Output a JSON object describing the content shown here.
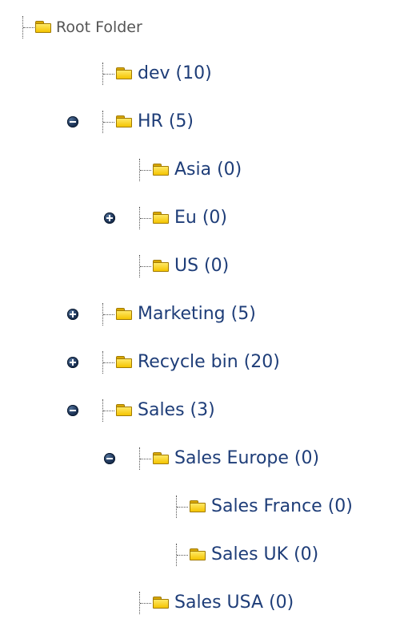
{
  "tree": {
    "root": {
      "label": "Root Folder"
    },
    "nodes": [
      {
        "label": "dev (10)",
        "depth": 1,
        "toggle": "none"
      },
      {
        "label": "HR (5)",
        "depth": 1,
        "toggle": "minus"
      },
      {
        "label": "Asia (0)",
        "depth": 2,
        "toggle": "none"
      },
      {
        "label": "Eu (0)",
        "depth": 2,
        "toggle": "plus"
      },
      {
        "label": "US (0)",
        "depth": 2,
        "toggle": "none"
      },
      {
        "label": "Marketing (5)",
        "depth": 1,
        "toggle": "plus"
      },
      {
        "label": "Recycle bin (20)",
        "depth": 1,
        "toggle": "plus"
      },
      {
        "label": "Sales (3)",
        "depth": 1,
        "toggle": "minus"
      },
      {
        "label": "Sales Europe (0)",
        "depth": 2,
        "toggle": "minus"
      },
      {
        "label": "Sales France (0)",
        "depth": 3,
        "toggle": "none"
      },
      {
        "label": "Sales UK (0)",
        "depth": 3,
        "toggle": "none"
      },
      {
        "label": "Sales USA (0)",
        "depth": 2,
        "toggle": "none"
      }
    ]
  },
  "icons": {
    "folder": "folder-icon",
    "expand": "plus-icon",
    "collapse": "minus-icon"
  },
  "colors": {
    "label": "#1e3d78",
    "root_label": "#555555",
    "folder_fill": "#f4c400",
    "toggle": "#1e3558"
  }
}
